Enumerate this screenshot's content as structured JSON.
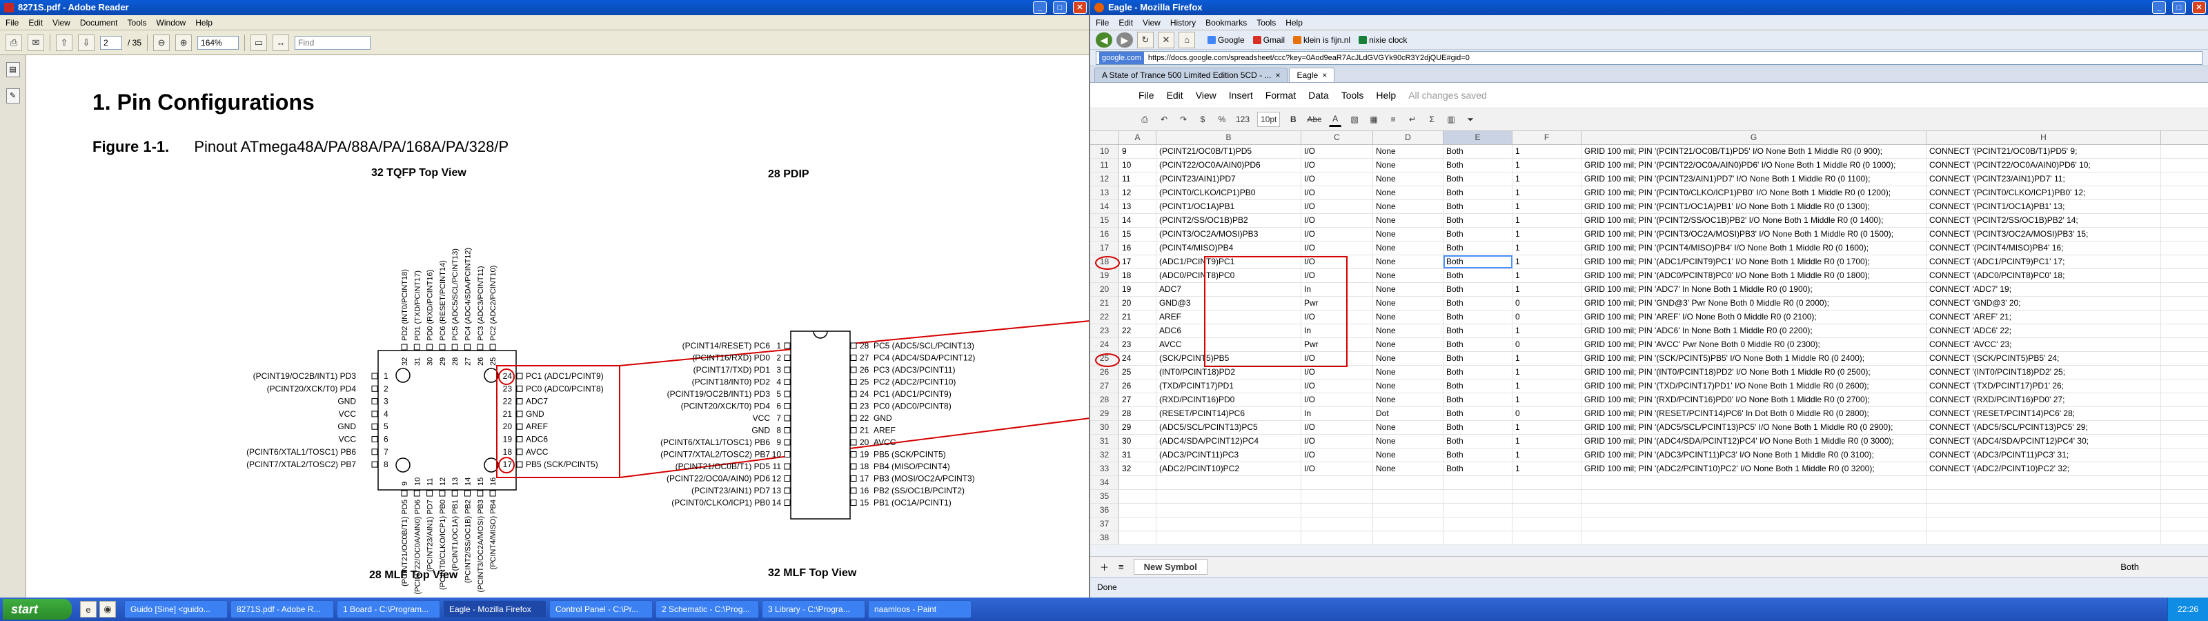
{
  "reader": {
    "title": "8271S.pdf - Adobe Reader",
    "menu": [
      "File",
      "Edit",
      "View",
      "Document",
      "Tools",
      "Window",
      "Help"
    ],
    "page_current": "2",
    "page_total": "/ 35",
    "zoom": "164%",
    "find_placeholder": "Find",
    "heading": "1.   Pin Configurations",
    "figure_label": "Figure 1-1.",
    "figure_caption": "Pinout ATmega48A/PA/88A/PA/168A/PA/328/P",
    "tqfp_title": "32 TQFP Top View",
    "pdip_title": "28 PDIP",
    "mlf28_title": "28 MLF Top View",
    "mlf32_title": "32 MLF Top View",
    "tqfp_left": [
      {
        "num": "1",
        "name": "(PCINT19/OC2B/INT1) PD3"
      },
      {
        "num": "2",
        "name": "(PCINT20/XCK/T0) PD4"
      },
      {
        "num": "3",
        "name": "GND"
      },
      {
        "num": "4",
        "name": "VCC"
      },
      {
        "num": "5",
        "name": "GND"
      },
      {
        "num": "6",
        "name": "VCC"
      },
      {
        "num": "7",
        "name": "(PCINT6/XTAL1/TOSC1) PB6"
      },
      {
        "num": "8",
        "name": "(PCINT7/XTAL2/TOSC2) PB7"
      }
    ],
    "tqfp_right": [
      {
        "num": "24",
        "name": "PC1 (ADC1/PCINT9)"
      },
      {
        "num": "23",
        "name": "PC0 (ADC0/PCINT8)"
      },
      {
        "num": "22",
        "name": "ADC7"
      },
      {
        "num": "21",
        "name": "GND"
      },
      {
        "num": "20",
        "name": "AREF"
      },
      {
        "num": "19",
        "name": "ADC6"
      },
      {
        "num": "18",
        "name": "AVCC"
      },
      {
        "num": "17",
        "name": "PB5 (SCK/PCINT5)"
      }
    ],
    "tqfp_top": [
      "PD2 (INT0/PCINT18)",
      "PD1 (TXD/PCINT17)",
      "PD0 (RXD/PCINT16)",
      "PC6 (RESET/PCINT14)",
      "PC5 (ADC5/SCL/PCINT13)",
      "PC4 (ADC4/SDA/PCINT12)",
      "PC3 (ADC3/PCINT11)",
      "PC2 (ADC2/PCINT10)"
    ],
    "tqfp_top_nums": [
      "32",
      "31",
      "30",
      "29",
      "28",
      "27",
      "26",
      "25"
    ],
    "tqfp_bottom": [
      "(PCINT21/OC0B/T1) PD5",
      "(PCINT22/OC0A/AIN0) PD6",
      "(PCINT23/AIN1) PD7",
      "(PCINT0/CLKO/ICP1) PB0",
      "(PCINT1/OC1A) PB1",
      "(PCINT2/SS/OC1B) PB2",
      "(PCINT3/OC2A/MOSI) PB3",
      "(PCINT4/MISO) PB4"
    ],
    "tqfp_bottom_nums": [
      "9",
      "10",
      "11",
      "12",
      "13",
      "14",
      "15",
      "16"
    ],
    "pdip_left": [
      {
        "num": "1",
        "name": "(PCINT14/RESET) PC6"
      },
      {
        "num": "2",
        "name": "(PCINT16/RXD) PD0"
      },
      {
        "num": "3",
        "name": "(PCINT17/TXD) PD1"
      },
      {
        "num": "4",
        "name": "(PCINT18/INT0) PD2"
      },
      {
        "num": "5",
        "name": "(PCINT19/OC2B/INT1) PD3"
      },
      {
        "num": "6",
        "name": "(PCINT20/XCK/T0) PD4"
      },
      {
        "num": "7",
        "name": "VCC"
      },
      {
        "num": "8",
        "name": "GND"
      },
      {
        "num": "9",
        "name": "(PCINT6/XTAL1/TOSC1) PB6"
      },
      {
        "num": "10",
        "name": "(PCINT7/XTAL2/TOSC2) PB7"
      },
      {
        "num": "11",
        "name": "(PCINT21/OC0B/T1) PD5"
      },
      {
        "num": "12",
        "name": "(PCINT22/OC0A/AIN0) PD6"
      },
      {
        "num": "13",
        "name": "(PCINT23/AIN1) PD7"
      },
      {
        "num": "14",
        "name": "(PCINT0/CLKO/ICP1) PB0"
      }
    ],
    "pdip_right": [
      {
        "num": "28",
        "name": "PC5 (ADC5/SCL/PCINT13)"
      },
      {
        "num": "27",
        "name": "PC4 (ADC4/SDA/PCINT12)"
      },
      {
        "num": "26",
        "name": "PC3 (ADC3/PCINT11)"
      },
      {
        "num": "25",
        "name": "PC2 (ADC2/PCINT10)"
      },
      {
        "num": "24",
        "name": "PC1 (ADC1/PCINT9)"
      },
      {
        "num": "23",
        "name": "PC0 (ADC0/PCINT8)"
      },
      {
        "num": "22",
        "name": "GND"
      },
      {
        "num": "21",
        "name": "AREF"
      },
      {
        "num": "20",
        "name": "AVCC"
      },
      {
        "num": "19",
        "name": "PB5 (SCK/PCINT5)"
      },
      {
        "num": "18",
        "name": "PB4 (MISO/PCINT4)"
      },
      {
        "num": "17",
        "name": "PB3 (MOSI/OC2A/PCINT3)"
      },
      {
        "num": "16",
        "name": "PB2 (SS/OC1B/PCINT2)"
      },
      {
        "num": "15",
        "name": "PB1 (OC1A/PCINT1)"
      }
    ]
  },
  "firefox": {
    "title": "Eagle - Mozilla Firefox",
    "menu": [
      "File",
      "Edit",
      "View",
      "History",
      "Bookmarks",
      "Tools",
      "Help"
    ],
    "bookmarks": [
      "Google",
      "Gmail",
      "klein is fijn.nl",
      "nixie clock"
    ],
    "url_site": "google.com",
    "url": "https://docs.google.com/spreadsheet/ccc?key=0Aod9eaR7AcJLdGVGYk90cR3Y2djQUE#gid=0",
    "tabs": [
      "A State of Trance 500 Limited Edition 5CD - ...",
      "Eagle"
    ],
    "status": "Done"
  },
  "sheet": {
    "menu": [
      "File",
      "Edit",
      "View",
      "Insert",
      "Format",
      "Data",
      "Tools",
      "Help"
    ],
    "save_status": "All changes saved",
    "toolbar": {
      "zoom": "10pt",
      "format": "123",
      "bold": "B",
      "underline": "Abc",
      "font_color": "A",
      "sum": "Σ"
    },
    "columns": [
      "A",
      "B",
      "C",
      "D",
      "E",
      "F",
      "G",
      "H"
    ],
    "rows": [
      {
        "n": "10",
        "a": "9",
        "b": "(PCINT21/OC0B/T1)PD5",
        "c": "I/O",
        "d": "None",
        "e": "Both",
        "f": "1",
        "g": "GRID 100 mil; PIN '(PCINT21/OC0B/T1)PD5' I/O None Both 1 Middle R0 (0 900);",
        "h": "CONNECT '(PCINT21/OC0B/T1)PD5' 9;"
      },
      {
        "n": "11",
        "a": "10",
        "b": "(PCINT22/OC0A/AIN0)PD6",
        "c": "I/O",
        "d": "None",
        "e": "Both",
        "f": "1",
        "g": "GRID 100 mil; PIN '(PCINT22/OC0A/AIN0)PD6' I/O None Both 1 Middle R0 (0 1000);",
        "h": "CONNECT '(PCINT22/OC0A/AIN0)PD6' 10;"
      },
      {
        "n": "12",
        "a": "11",
        "b": "(PCINT23/AIN1)PD7",
        "c": "I/O",
        "d": "None",
        "e": "Both",
        "f": "1",
        "g": "GRID 100 mil; PIN '(PCINT23/AIN1)PD7' I/O None Both 1 Middle R0 (0 1100);",
        "h": "CONNECT '(PCINT23/AIN1)PD7' 11;"
      },
      {
        "n": "13",
        "a": "12",
        "b": "(PCINT0/CLKO/ICP1)PB0",
        "c": "I/O",
        "d": "None",
        "e": "Both",
        "f": "1",
        "g": "GRID 100 mil; PIN '(PCINT0/CLKO/ICP1)PB0' I/O None Both 1 Middle R0 (0 1200);",
        "h": "CONNECT '(PCINT0/CLKO/ICP1)PB0' 12;"
      },
      {
        "n": "14",
        "a": "13",
        "b": "(PCINT1/OC1A)PB1",
        "c": "I/O",
        "d": "None",
        "e": "Both",
        "f": "1",
        "g": "GRID 100 mil; PIN '(PCINT1/OC1A)PB1' I/O None Both 1 Middle R0 (0 1300);",
        "h": "CONNECT '(PCINT1/OC1A)PB1' 13;"
      },
      {
        "n": "15",
        "a": "14",
        "b": "(PCINT2/SS/OC1B)PB2",
        "c": "I/O",
        "d": "None",
        "e": "Both",
        "f": "1",
        "g": "GRID 100 mil; PIN '(PCINT2/SS/OC1B)PB2' I/O None Both 1 Middle R0 (0 1400);",
        "h": "CONNECT '(PCINT2/SS/OC1B)PB2' 14;"
      },
      {
        "n": "16",
        "a": "15",
        "b": "(PCINT3/OC2A/MOSI)PB3",
        "c": "I/O",
        "d": "None",
        "e": "Both",
        "f": "1",
        "g": "GRID 100 mil; PIN '(PCINT3/OC2A/MOSI)PB3' I/O None Both 1 Middle R0 (0 1500);",
        "h": "CONNECT '(PCINT3/OC2A/MOSI)PB3' 15;"
      },
      {
        "n": "17",
        "a": "16",
        "b": "(PCINT4/MISO)PB4",
        "c": "I/O",
        "d": "None",
        "e": "Both",
        "f": "1",
        "g": "GRID 100 mil; PIN '(PCINT4/MISO)PB4' I/O None Both 1 Middle R0 (0 1600);",
        "h": "CONNECT '(PCINT4/MISO)PB4' 16;"
      },
      {
        "n": "18",
        "a": "17",
        "b": "(ADC1/PCINT9)PC1",
        "c": "I/O",
        "d": "None",
        "e": "Both",
        "f": "1",
        "g": "GRID 100 mil; PIN '(ADC1/PCINT9)PC1' I/O None Both 1 Middle R0 (0 1700);",
        "h": "CONNECT '(ADC1/PCINT9)PC1' 17;"
      },
      {
        "n": "19",
        "a": "18",
        "b": "(ADC0/PCINT8)PC0",
        "c": "I/O",
        "d": "None",
        "e": "Both",
        "f": "1",
        "g": "GRID 100 mil; PIN '(ADC0/PCINT8)PC0' I/O None Both 1 Middle R0 (0 1800);",
        "h": "CONNECT '(ADC0/PCINT8)PC0' 18;"
      },
      {
        "n": "20",
        "a": "19",
        "b": "ADC7",
        "c": "In",
        "d": "None",
        "e": "Both",
        "f": "1",
        "g": "GRID 100 mil; PIN 'ADC7' In None Both 1 Middle R0 (0 1900);",
        "h": "CONNECT 'ADC7' 19;"
      },
      {
        "n": "21",
        "a": "20",
        "b": "GND@3",
        "c": "Pwr",
        "d": "None",
        "e": "Both",
        "f": "0",
        "g": "GRID 100 mil; PIN 'GND@3' Pwr None Both 0 Middle R0 (0 2000);",
        "h": "CONNECT 'GND@3' 20;"
      },
      {
        "n": "22",
        "a": "21",
        "b": "AREF",
        "c": "I/O",
        "d": "None",
        "e": "Both",
        "f": "0",
        "g": "GRID 100 mil; PIN 'AREF' I/O None Both 0 Middle R0 (0 2100);",
        "h": "CONNECT 'AREF' 21;"
      },
      {
        "n": "23",
        "a": "22",
        "b": "ADC6",
        "c": "In",
        "d": "None",
        "e": "Both",
        "f": "1",
        "g": "GRID 100 mil; PIN 'ADC6' In None Both 1 Middle R0 (0 2200);",
        "h": "CONNECT 'ADC6' 22;"
      },
      {
        "n": "24",
        "a": "23",
        "b": "AVCC",
        "c": "Pwr",
        "d": "None",
        "e": "Both",
        "f": "0",
        "g": "GRID 100 mil; PIN 'AVCC' Pwr None Both 0 Middle R0 (0 2300);",
        "h": "CONNECT 'AVCC' 23;"
      },
      {
        "n": "25",
        "a": "24",
        "b": "(SCK/PCINT5)PB5",
        "c": "I/O",
        "d": "None",
        "e": "Both",
        "f": "1",
        "g": "GRID 100 mil; PIN '(SCK/PCINT5)PB5' I/O None Both 1 Middle R0 (0 2400);",
        "h": "CONNECT '(SCK/PCINT5)PB5' 24;"
      },
      {
        "n": "26",
        "a": "25",
        "b": "(INT0/PCINT18)PD2",
        "c": "I/O",
        "d": "None",
        "e": "Both",
        "f": "1",
        "g": "GRID 100 mil; PIN '(INT0/PCINT18)PD2' I/O None Both 1 Middle R0 (0 2500);",
        "h": "CONNECT '(INT0/PCINT18)PD2' 25;"
      },
      {
        "n": "27",
        "a": "26",
        "b": "(TXD/PCINT17)PD1",
        "c": "I/O",
        "d": "None",
        "e": "Both",
        "f": "1",
        "g": "GRID 100 mil; PIN '(TXD/PCINT17)PD1' I/O None Both 1 Middle R0 (0 2600);",
        "h": "CONNECT '(TXD/PCINT17)PD1' 26;"
      },
      {
        "n": "28",
        "a": "27",
        "b": "(RXD/PCINT16)PD0",
        "c": "I/O",
        "d": "None",
        "e": "Both",
        "f": "1",
        "g": "GRID 100 mil; PIN '(RXD/PCINT16)PD0' I/O None Both 1 Middle R0 (0 2700);",
        "h": "CONNECT '(RXD/PCINT16)PD0' 27;"
      },
      {
        "n": "29",
        "a": "28",
        "b": "(RESET/PCINT14)PC6",
        "c": "In",
        "d": "Dot",
        "e": "Both",
        "f": "0",
        "g": "GRID 100 mil; PIN '(RESET/PCINT14)PC6' In Dot Both 0 Middle R0 (0 2800);",
        "h": "CONNECT '(RESET/PCINT14)PC6' 28;"
      },
      {
        "n": "30",
        "a": "29",
        "b": "(ADC5/SCL/PCINT13)PC5",
        "c": "I/O",
        "d": "None",
        "e": "Both",
        "f": "1",
        "g": "GRID 100 mil; PIN '(ADC5/SCL/PCINT13)PC5' I/O None Both 1 Middle R0 (0 2900);",
        "h": "CONNECT '(ADC5/SCL/PCINT13)PC5' 29;"
      },
      {
        "n": "31",
        "a": "30",
        "b": "(ADC4/SDA/PCINT12)PC4",
        "c": "I/O",
        "d": "None",
        "e": "Both",
        "f": "1",
        "g": "GRID 100 mil; PIN '(ADC4/SDA/PCINT12)PC4' I/O None Both 1 Middle R0 (0 3000);",
        "h": "CONNECT '(ADC4/SDA/PCINT12)PC4' 30;"
      },
      {
        "n": "32",
        "a": "31",
        "b": "(ADC3/PCINT11)PC3",
        "c": "I/O",
        "d": "None",
        "e": "Both",
        "f": "1",
        "g": "GRID 100 mil; PIN '(ADC3/PCINT11)PC3' I/O None Both 1 Middle R0 (0 3100);",
        "h": "CONNECT '(ADC3/PCINT11)PC3' 31;"
      },
      {
        "n": "33",
        "a": "32",
        "b": "(ADC2/PCINT10)PC2",
        "c": "I/O",
        "d": "None",
        "e": "Both",
        "f": "1",
        "g": "GRID 100 mil; PIN '(ADC2/PCINT10)PC2' I/O None Both 1 Middle R0 (0 3200);",
        "h": "CONNECT '(ADC2/PCINT10)PC2' 32;"
      }
    ],
    "empty_rows": [
      "34",
      "35",
      "36",
      "37",
      "38"
    ],
    "sheet_tab": "New Symbol",
    "selected_value": "Both"
  },
  "taskbar": {
    "start": "start",
    "tasks": [
      "Guido [Sine] <guido...",
      "8271S.pdf - Adobe R...",
      "1 Board - C:\\Program...",
      "Eagle - Mozilla Firefox",
      "Control Panel - C:\\Pr...",
      "2 Schematic - C:\\Prog...",
      "3 Library - C:\\Progra...",
      "naamloos - Paint"
    ],
    "clock": "22:26"
  },
  "colors": {
    "highlight": "#d40000",
    "active_cell": "#4d90fe"
  }
}
